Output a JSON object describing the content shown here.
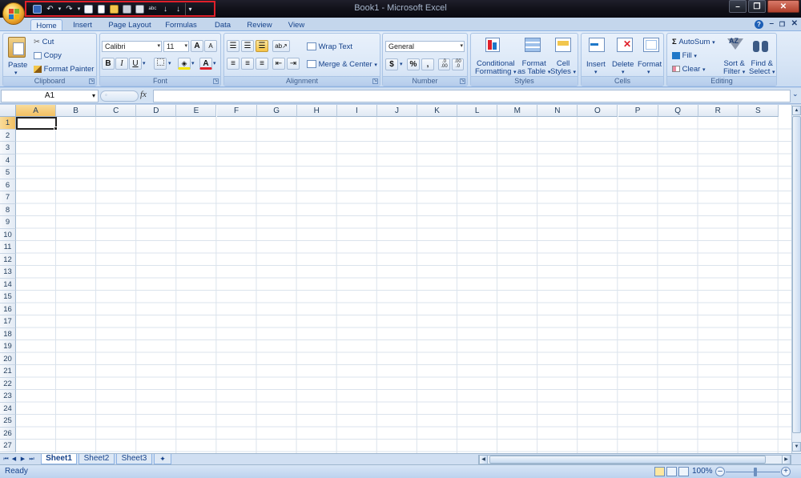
{
  "window": {
    "title": "Book1 - Microsoft Excel",
    "controls": [
      "–",
      "❐",
      "✕"
    ]
  },
  "quick_access": {
    "icons": [
      "save-icon",
      "undo-icon",
      "redo-icon",
      "print-preview-icon",
      "new-icon",
      "open-icon",
      "quick-print-icon",
      "spelling-icon",
      "sort-ascending-icon",
      "sort-descending-icon",
      "customize-icon"
    ]
  },
  "tabs": [
    "Home",
    "Insert",
    "Page Layout",
    "Formulas",
    "Data",
    "Review",
    "View"
  ],
  "active_tab": "Home",
  "ribbon": {
    "clipboard": {
      "title": "Clipboard",
      "paste": "Paste",
      "cut": "Cut",
      "copy": "Copy",
      "format_painter": "Format Painter"
    },
    "font": {
      "title": "Font",
      "family": "Calibri",
      "size": "11",
      "bold": "B",
      "italic": "I",
      "underline": "U",
      "grow": "A",
      "shrink": "A",
      "font_color_letter": "A"
    },
    "alignment": {
      "title": "Alignment",
      "wrap_text": "Wrap Text",
      "merge_center": "Merge & Center"
    },
    "number": {
      "title": "Number",
      "format": "General",
      "currency": "$",
      "percent": "%",
      "comma": ",",
      "inc_decimal": ".0 .00",
      "dec_decimal": ".00 .0"
    },
    "styles": {
      "title": "Styles",
      "conditional_1": "Conditional",
      "conditional_2": "Formatting",
      "format_table_1": "Format",
      "format_table_2": "as Table",
      "cell_styles_1": "Cell",
      "cell_styles_2": "Styles"
    },
    "cells": {
      "title": "Cells",
      "insert": "Insert",
      "delete": "Delete",
      "format": "Format"
    },
    "editing": {
      "title": "Editing",
      "autosum": "AutoSum",
      "fill": "Fill",
      "clear": "Clear",
      "sort_1": "Sort &",
      "sort_2": "Filter",
      "find_1": "Find &",
      "find_2": "Select"
    }
  },
  "formula_bar": {
    "name_box": "A1",
    "fx": "fx",
    "formula": ""
  },
  "sheet": {
    "columns": [
      "A",
      "B",
      "C",
      "D",
      "E",
      "F",
      "G",
      "H",
      "I",
      "J",
      "K",
      "L",
      "M",
      "N",
      "O",
      "P",
      "Q",
      "R",
      "S"
    ],
    "rows": [
      "1",
      "2",
      "3",
      "4",
      "5",
      "6",
      "7",
      "8",
      "9",
      "10",
      "11",
      "12",
      "13",
      "14",
      "15",
      "16",
      "17",
      "18",
      "19",
      "20",
      "21",
      "22",
      "23",
      "24",
      "25",
      "26",
      "27"
    ],
    "selected_cell": "A1"
  },
  "sheet_tabs": [
    "Sheet1",
    "Sheet2",
    "Sheet3"
  ],
  "active_sheet": "Sheet1",
  "status": {
    "text": "Ready",
    "zoom": "100%"
  },
  "colors": {
    "accent": "#15428b",
    "ribbon_bg": "#dae7f7",
    "highlight": "#e0202a"
  }
}
